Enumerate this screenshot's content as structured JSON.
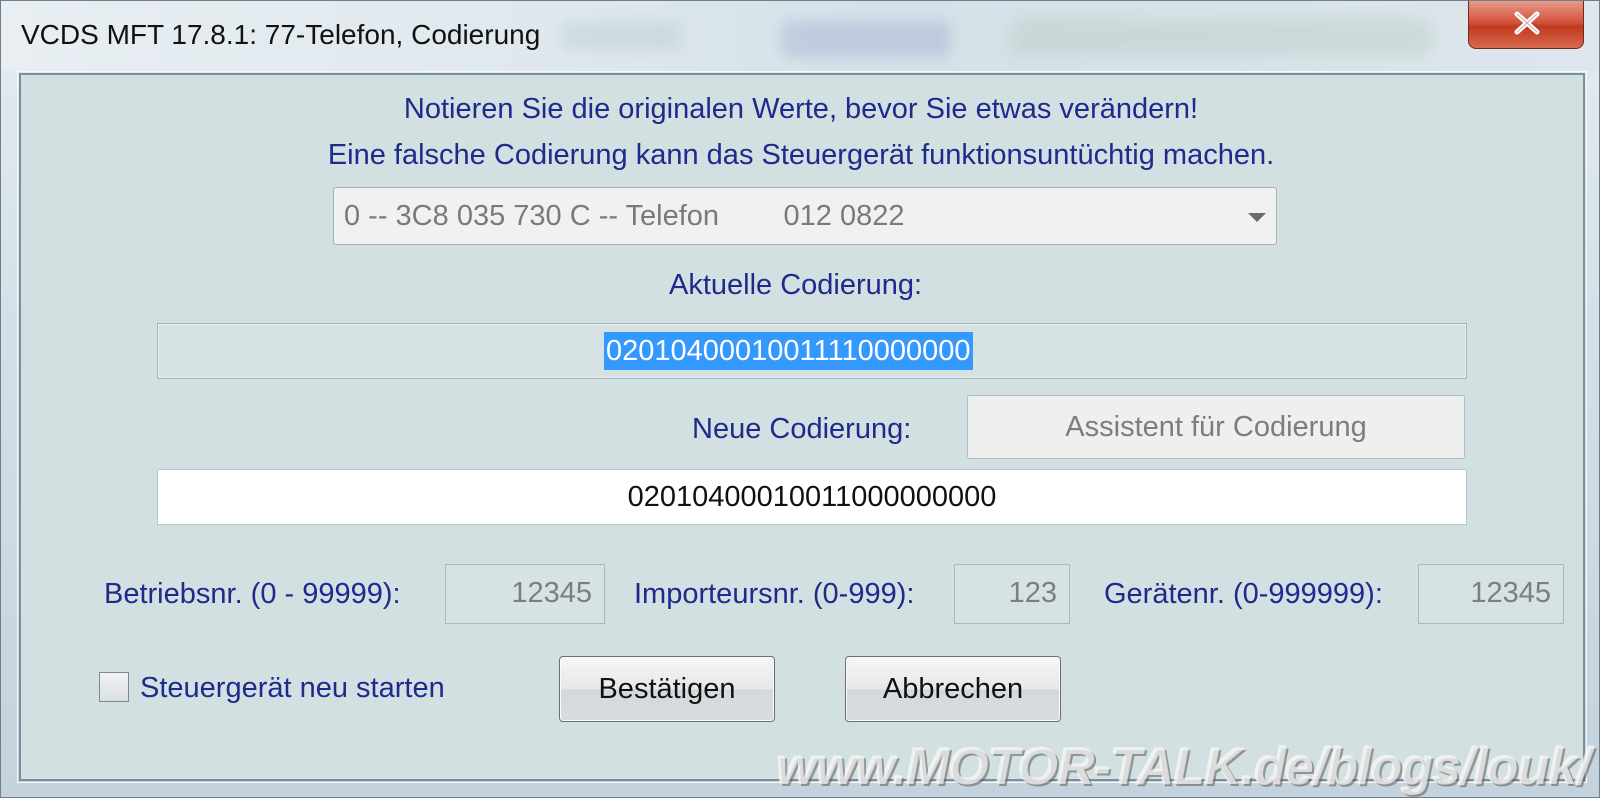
{
  "window": {
    "title": "VCDS MFT 17.8.1: 77-Telefon,  Codierung"
  },
  "notice": {
    "line1": "Notieren Sie die originalen Werte, bevor Sie etwas verändern!",
    "line2": "Eine falsche Codierung kann das Steuergerät funktionsuntüchtig machen."
  },
  "module_select": {
    "value": "0 -- 3C8 035 730 C -- Telefon        012 0822"
  },
  "current_coding": {
    "label": "Aktuelle Codierung:",
    "value": "02010400010011110000000"
  },
  "new_coding": {
    "label": "Neue Codierung:",
    "value": "02010400010011000000000",
    "assistant_button": "Assistent für Codierung"
  },
  "fields": {
    "workshop_label": "Betriebsnr. (0 - 99999):",
    "workshop_value": "12345",
    "importer_label": "Importeursnr. (0-999):",
    "importer_value": "123",
    "device_label": "Gerätenr. (0-999999):",
    "device_value": "12345"
  },
  "restart": {
    "label": "Steuergerät neu starten",
    "checked": false
  },
  "buttons": {
    "confirm": "Bestätigen",
    "cancel": "Abbrechen"
  },
  "watermark": "www.MOTOR-TALK.de/blogs/louk/",
  "colors": {
    "label_text": "#1e2a8c",
    "selection": "#3399ff",
    "close_button": "#c0391f",
    "dialog_background": "#d3e0e1"
  }
}
